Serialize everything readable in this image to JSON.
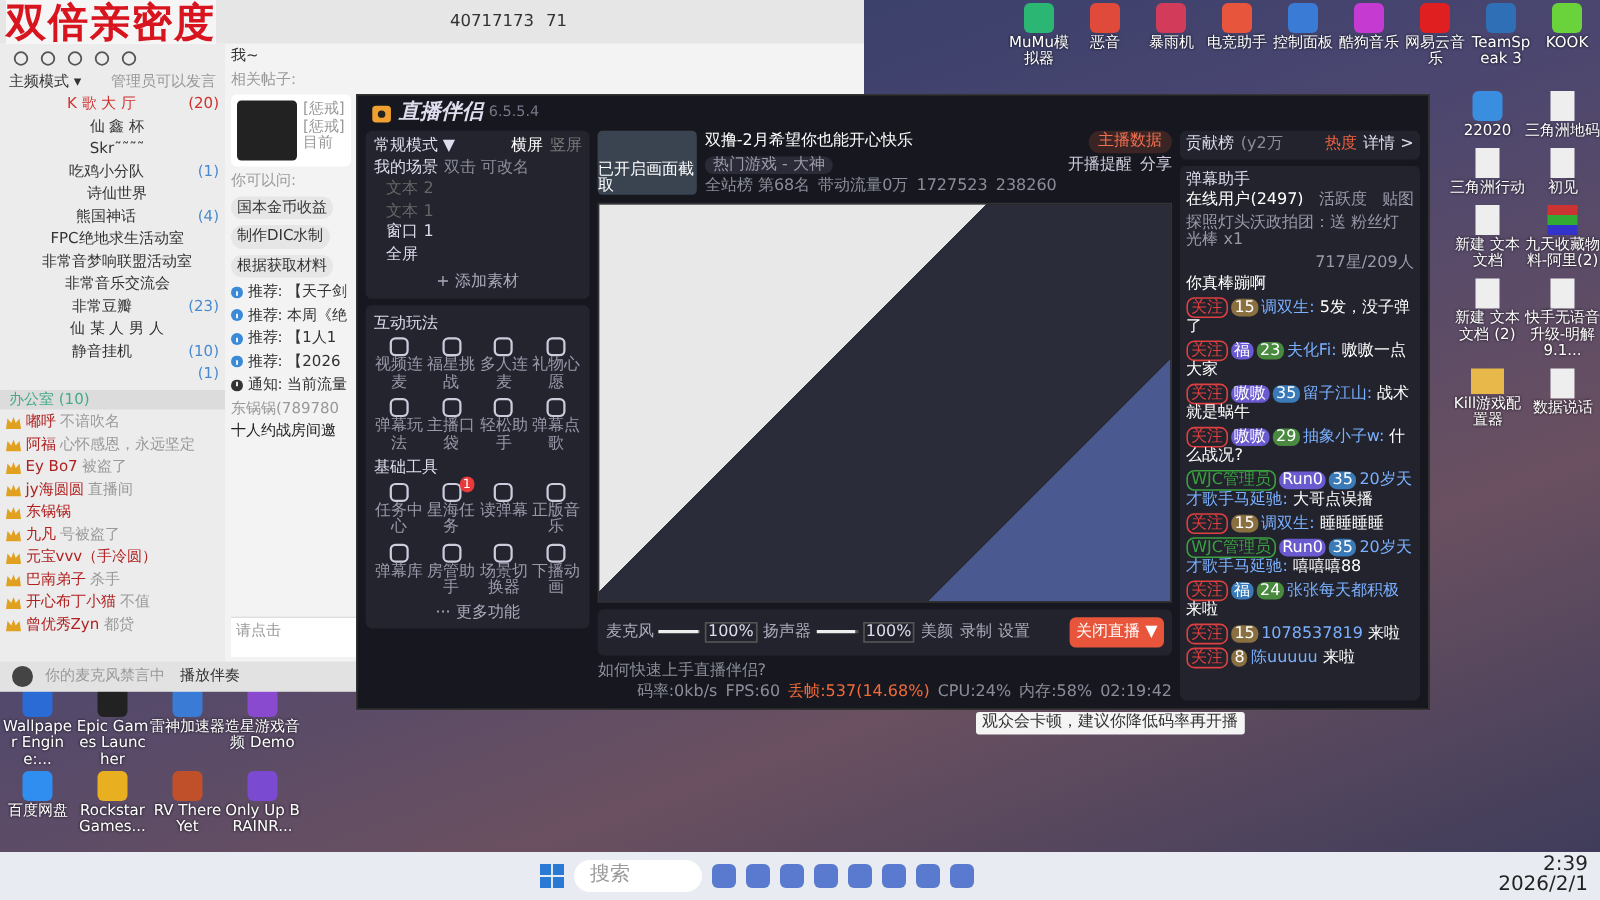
{
  "overlay_title": "双倍亲密度",
  "desktop": {
    "top_icons": [
      {
        "label": "MuMu模拟器",
        "kind": "app",
        "color": "#2bb673"
      },
      {
        "label": "恶音",
        "kind": "app",
        "color": "#e04a3a"
      },
      {
        "label": "暴雨机",
        "kind": "app",
        "color": "#d23b5a"
      },
      {
        "label": "电竞助手",
        "kind": "app",
        "color": "#e8553d"
      },
      {
        "label": "控制面板",
        "kind": "app",
        "color": "#3a7bd5"
      },
      {
        "label": "酷狗音乐",
        "kind": "app",
        "color": "#c53ad0"
      },
      {
        "label": "网易云音乐",
        "kind": "app",
        "color": "#e02020"
      },
      {
        "label": "TeamSpeak 3",
        "kind": "app",
        "color": "#2f6fb5"
      },
      {
        "label": "KOOK",
        "kind": "app",
        "color": "#6ad23a"
      }
    ],
    "right_icons": [
      {
        "label": "22020",
        "kind": "app",
        "color": "#3a8ee0"
      },
      {
        "label": "三角洲地码",
        "kind": "doc"
      },
      {
        "label": "三角洲行动",
        "kind": "doc"
      },
      {
        "label": "初见",
        "kind": "doc"
      },
      {
        "label": "新建 文本文档",
        "kind": "doc"
      },
      {
        "label": "九天收藏物料-阿里(2)",
        "kind": "archive"
      },
      {
        "label": "新建 文本文档 (2)",
        "kind": "doc"
      },
      {
        "label": "快手无语音升级-明解 9.1...",
        "kind": "doc"
      },
      {
        "label": "Kill游戏配置器",
        "kind": "folder"
      },
      {
        "label": "数据说话",
        "kind": "doc"
      }
    ],
    "bottom_icons": [
      {
        "label": "Wallpaper Engine:...",
        "kind": "app",
        "color": "#2b6bd6"
      },
      {
        "label": "Epic Games Launcher",
        "kind": "app",
        "color": "#222222"
      },
      {
        "label": "雷神加速器",
        "kind": "app",
        "color": "#3a7bd5"
      },
      {
        "label": "造星游戏音频 Demo",
        "kind": "app",
        "color": "#8a4ad0"
      },
      {
        "label": "百度网盘",
        "kind": "app",
        "color": "#2f8ef0"
      },
      {
        "label": "Rockstar Games...",
        "kind": "app",
        "color": "#e8b020"
      },
      {
        "label": "RV There Yet",
        "kind": "app",
        "color": "#c0502a"
      },
      {
        "label": "Only Up BRAINR...",
        "kind": "app",
        "color": "#7a4ad0"
      }
    ]
  },
  "chat_app": {
    "top_id": "40717173",
    "top_count": "71",
    "mode": "主频模式 ▾",
    "mode_hint": "管理员可以发言",
    "channels": [
      {
        "name": "K 歌 大 厅",
        "count": "(20)",
        "selected": true
      },
      {
        "name": "仙 鑫 杯",
        "selected": false
      },
      {
        "name": "Skr˜˜˜˜",
        "selected": false
      },
      {
        "name": "吃鸡小分队",
        "count": "(1)",
        "selected": false
      },
      {
        "name": "诗仙世界",
        "selected": false
      },
      {
        "name": "熊国神话",
        "count": "(4)",
        "selected": false
      },
      {
        "name": "FPC绝地求生活动室",
        "selected": false
      },
      {
        "name": "非常音梦响联盟活动室",
        "selected": false
      },
      {
        "name": "非常音乐交流会",
        "selected": false
      },
      {
        "name": "非常豆瓣",
        "count": "(23)",
        "selected": false
      },
      {
        "name": "仙 某 人 男 人",
        "selected": false
      },
      {
        "name": "静音挂机",
        "count": "(10)",
        "selected": false
      },
      {
        "count": "(1)",
        "selected": false
      }
    ],
    "office": {
      "name": "办公室",
      "count": "(10)"
    },
    "members": [
      {
        "name": "嘟呼",
        "status": "不谙吹名"
      },
      {
        "name": "阿福",
        "status": "心怀感恩，永远坚定"
      },
      {
        "name": "Ey Bo7",
        "status": "被盗了"
      },
      {
        "name": "jy海圆圆",
        "status": "直播间"
      },
      {
        "name": "东锅锅"
      },
      {
        "name": "九凡",
        "status": "号被盗了"
      },
      {
        "name": "元宝vvv（手冷圆）"
      },
      {
        "name": "巴南弟子",
        "status": "杀手"
      },
      {
        "name": "开心布丁小猫",
        "status": "不值"
      },
      {
        "name": "曾优秀Zyn",
        "status": "都贷"
      }
    ],
    "mic_hint": "你的麦克风禁言中",
    "play_music": "播放伴奏",
    "header": "我~",
    "related": "相关帖子:",
    "post_lines": [
      "[惩戒]",
      "[惩戒]",
      "目前"
    ],
    "ask_label": "你可以问:",
    "suggestions": [
      "国本金币收益",
      "制作DIC水制",
      "根据获取材料"
    ],
    "notices": [
      {
        "kind": "recommend",
        "text": "推荐: 【天子剑"
      },
      {
        "kind": "recommend",
        "text": "推荐: 本周《绝"
      },
      {
        "kind": "recommend",
        "text": "推荐: 【1人1"
      },
      {
        "kind": "recommend",
        "text": "推荐: 【2026"
      },
      {
        "kind": "notice",
        "text": "通知: 当前流量"
      }
    ],
    "invite_from": "东锅锅(789780",
    "invite": "十人约战房间邀",
    "input_placeholder": "请点击"
  },
  "streamer": {
    "title": "直播伴侣",
    "version": "6.5.5.4",
    "mode": "常规模式 ▼",
    "orientations": [
      {
        "label": "横屏",
        "selected": true
      },
      {
        "label": "竖屏",
        "selected": false
      }
    ],
    "scenes_label": "我的场景",
    "scenes_hint": "双击 可改名",
    "sources": [
      {
        "name": "文本 2",
        "enabled": false
      },
      {
        "name": "文本 1",
        "enabled": false
      },
      {
        "name": "窗口 1",
        "enabled": true
      },
      {
        "name": "全屏",
        "enabled": true
      }
    ],
    "add_source": "+ 添加素材",
    "interactive_title": "互动玩法",
    "interactive": [
      "视频连麦",
      "福星挑战",
      "多人连麦",
      "礼物心愿",
      "弹幕玩法",
      "主播口袋",
      "轻松助手",
      "弹幕点歌"
    ],
    "tools_title": "基础工具",
    "tools": [
      {
        "label": "任务中心"
      },
      {
        "label": "星海任务",
        "badge": "1"
      },
      {
        "label": "读弹幕"
      },
      {
        "label": "正版音乐"
      },
      {
        "label": "弹幕库"
      },
      {
        "label": "房管助手"
      },
      {
        "label": "场景切换器"
      },
      {
        "label": "下播动画"
      }
    ],
    "more": "··· 更多功能",
    "data_button": "主播数据",
    "stream_title": "双撸-2月希望你也能开心快乐",
    "capture_note": "已开启画面截取",
    "category": "热门游戏 - 大神",
    "remind": "开播提醒",
    "share": "分享",
    "rank": "全站榜 第68名",
    "traffic": "带动流量0万",
    "likes": "1727523",
    "hearts": "238260",
    "mic_label": "麦克风",
    "mic_volume": {
      "level": 0.95,
      "reading": "100%"
    },
    "speaker_label": "扬声器",
    "speaker_volume": {
      "level": 0.95,
      "reading": "100%"
    },
    "beauty": "美颜",
    "record": "录制",
    "settings": "设置",
    "stop_button": "关闭直播 ▼",
    "help": "如何快速上手直播伴侣?",
    "stats": [
      {
        "text": "码率:0kb/s",
        "warn": false
      },
      {
        "text": "FPS:60",
        "warn": false
      },
      {
        "text": "丢帧:537(14.68%)",
        "warn": true
      },
      {
        "text": "CPU:24%",
        "warn": false
      },
      {
        "text": "内存:58%",
        "warn": false
      }
    ],
    "duration": "02:19:42",
    "tooltip": "观众会卡顿，建议你降低码率再开播",
    "contrib_label": "贡献榜",
    "contrib_value": "(y2万",
    "heat": "热度",
    "details": "详情 >",
    "danmu_title": "弹幕助手",
    "danmu_tabs": [
      {
        "label": "在线用户(2497)",
        "selected": true
      },
      {
        "label": "活跃度",
        "selected": false
      },
      {
        "label": "贴图",
        "selected": false
      }
    ],
    "gift": "探照灯头沃政拍团：送 粉丝灯光棒 x1",
    "audience": "717星/209人",
    "messages": [
      {
        "text": "你真棒蹦啊"
      },
      {
        "badges": [
          {
            "kind": "follow",
            "text": "关注"
          },
          {
            "kind": "level",
            "text": "15"
          }
        ],
        "user": "调双生:",
        "text": "5发，没子弹了"
      },
      {
        "badges": [
          {
            "kind": "follow",
            "text": "关注"
          },
          {
            "kind": "fan",
            "text": "福"
          },
          {
            "kind": "rank",
            "text": "23"
          }
        ],
        "user": "夫化Fi:",
        "text": "嗷嗷一点大家"
      },
      {
        "badges": [
          {
            "kind": "follow",
            "text": "关注"
          },
          {
            "kind": "fan",
            "text": "嗷嗷"
          },
          {
            "kind": "club",
            "text": "35"
          }
        ],
        "user": "留子江山:",
        "text": "战术就是蜗牛"
      },
      {
        "badges": [
          {
            "kind": "follow",
            "text": "关注"
          },
          {
            "kind": "fan",
            "text": "嗷嗷"
          },
          {
            "kind": "rank",
            "text": "29"
          }
        ],
        "user": "抽象小子w:",
        "text": "什么战况?"
      },
      {
        "badges": [
          {
            "kind": "admin",
            "text": "WJC管理员"
          },
          {
            "kind": "fan",
            "text": "Run0"
          },
          {
            "kind": "club",
            "text": "35"
          }
        ],
        "user": "20岁天才歌手马延驰:",
        "text": "大哥点误播"
      },
      {
        "badges": [
          {
            "kind": "follow",
            "text": "关注"
          },
          {
            "kind": "level",
            "text": "15"
          }
        ],
        "user": "调双生:",
        "text": "睡睡睡睡"
      },
      {
        "badges": [
          {
            "kind": "admin",
            "text": "WJC管理员"
          },
          {
            "kind": "fan",
            "text": "Run0"
          },
          {
            "kind": "club",
            "text": "35"
          }
        ],
        "user": "20岁天才歌手马延驰:",
        "text": "嘻嘻嘻88"
      },
      {
        "badges": [
          {
            "kind": "follow",
            "text": "关注"
          },
          {
            "kind": "club",
            "text": "福"
          },
          {
            "kind": "rank",
            "text": "24"
          }
        ],
        "user": "张张每天都积极",
        "text": "来啦"
      },
      {
        "badges": [
          {
            "kind": "follow",
            "text": "关注"
          },
          {
            "kind": "level",
            "text": "15"
          }
        ],
        "user": "1078537819",
        "text": "来啦"
      },
      {
        "badges": [
          {
            "kind": "follow",
            "text": "关注"
          },
          {
            "kind": "level",
            "text": "8"
          }
        ],
        "user": "陈uuuuu",
        "text": "来啦"
      }
    ]
  },
  "taskbar": {
    "search_placeholder": "搜索",
    "time": "2:39",
    "date": "2026/2/1"
  }
}
